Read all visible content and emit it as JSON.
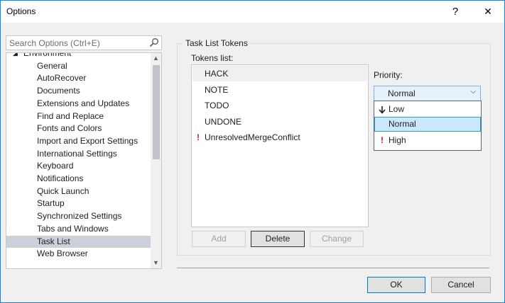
{
  "window": {
    "title": "Options",
    "help_glyph": "?",
    "close_glyph": "✕"
  },
  "search": {
    "placeholder": "Search Options (Ctrl+E)"
  },
  "tree": {
    "items": [
      {
        "label": "Environment",
        "level": 0,
        "expanded": true,
        "selected": false
      },
      {
        "label": "General",
        "level": 1,
        "selected": false
      },
      {
        "label": "AutoRecover",
        "level": 1,
        "selected": false
      },
      {
        "label": "Documents",
        "level": 1,
        "selected": false
      },
      {
        "label": "Extensions and Updates",
        "level": 1,
        "selected": false
      },
      {
        "label": "Find and Replace",
        "level": 1,
        "selected": false
      },
      {
        "label": "Fonts and Colors",
        "level": 1,
        "selected": false
      },
      {
        "label": "Import and Export Settings",
        "level": 1,
        "selected": false
      },
      {
        "label": "International Settings",
        "level": 1,
        "selected": false
      },
      {
        "label": "Keyboard",
        "level": 1,
        "selected": false
      },
      {
        "label": "Notifications",
        "level": 1,
        "selected": false
      },
      {
        "label": "Quick Launch",
        "level": 1,
        "selected": false
      },
      {
        "label": "Startup",
        "level": 1,
        "selected": false
      },
      {
        "label": "Synchronized Settings",
        "level": 1,
        "selected": false
      },
      {
        "label": "Tabs and Windows",
        "level": 1,
        "selected": false
      },
      {
        "label": "Task List",
        "level": 1,
        "selected": true
      },
      {
        "label": "Web Browser",
        "level": 1,
        "selected": false
      }
    ]
  },
  "group": {
    "title": "Task List Tokens"
  },
  "tokens": {
    "label": "Tokens list:",
    "items": [
      {
        "label": "HACK",
        "selected": true,
        "high_priority": false
      },
      {
        "label": "NOTE",
        "selected": false,
        "high_priority": false
      },
      {
        "label": "TODO",
        "selected": false,
        "high_priority": false
      },
      {
        "label": "UNDONE",
        "selected": false,
        "high_priority": false
      },
      {
        "label": "UnresolvedMergeConflict",
        "selected": false,
        "high_priority": true
      }
    ]
  },
  "priority": {
    "label": "Priority:",
    "value": "Normal",
    "options": [
      {
        "label": "Low",
        "icon": "arrow-down-icon",
        "selected": false
      },
      {
        "label": "Normal",
        "icon": "",
        "selected": true
      },
      {
        "label": "High",
        "icon": "exclamation-icon",
        "selected": false
      }
    ]
  },
  "buttons": {
    "add": "Add",
    "delete": "Delete",
    "change": "Change",
    "ok": "OK",
    "cancel": "Cancel"
  },
  "colors": {
    "accent": "#0078d7",
    "selection": "#cce8ff",
    "error": "#e51400"
  }
}
